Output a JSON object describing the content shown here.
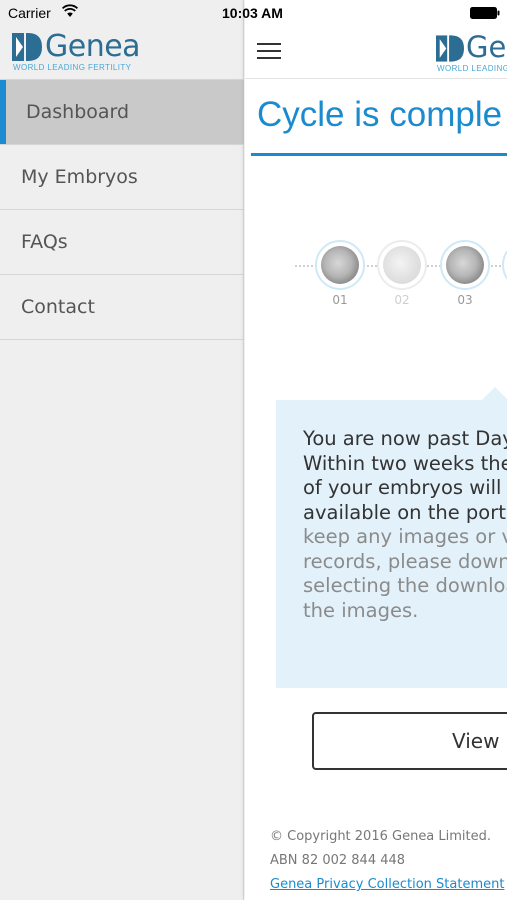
{
  "status_bar": {
    "carrier": "Carrier",
    "time": "10:03 AM"
  },
  "brand": {
    "name": "Genea",
    "tagline": "WORLD LEADING FERTILITY",
    "color": "#2b6d93",
    "accent": "#4aa7d8"
  },
  "menu": {
    "items": [
      {
        "label": "Dashboard",
        "active": true
      },
      {
        "label": "My Embryos",
        "active": false
      },
      {
        "label": "FAQs",
        "active": false
      },
      {
        "label": "Contact",
        "active": false
      }
    ],
    "active_color": "#1d8bd0"
  },
  "main": {
    "title": "Cycle is comple",
    "embryos": [
      {
        "number": "01",
        "faded": false
      },
      {
        "number": "02",
        "faded": true
      },
      {
        "number": "03",
        "faded": false
      }
    ],
    "info": {
      "lines_dark": [
        "You are now past Day",
        "Within two weeks the",
        "of your embryos will n",
        "available on the portal"
      ],
      "lines_light": [
        "keep any images or vic",
        "records, please downlo",
        "selecting the downloa",
        "the images."
      ]
    },
    "view_button": "View F",
    "footer": {
      "copyright": "© Copyright 2016 Genea Limited.",
      "abn": "ABN 82 002 844 448",
      "privacy_link": "Genea Privacy Collection Statement",
      "separator": "|"
    }
  },
  "icons": {
    "menu": "hamburger-icon",
    "wifi": "wifi-icon",
    "battery": "battery-icon",
    "logo": "genea-logo-mark"
  }
}
